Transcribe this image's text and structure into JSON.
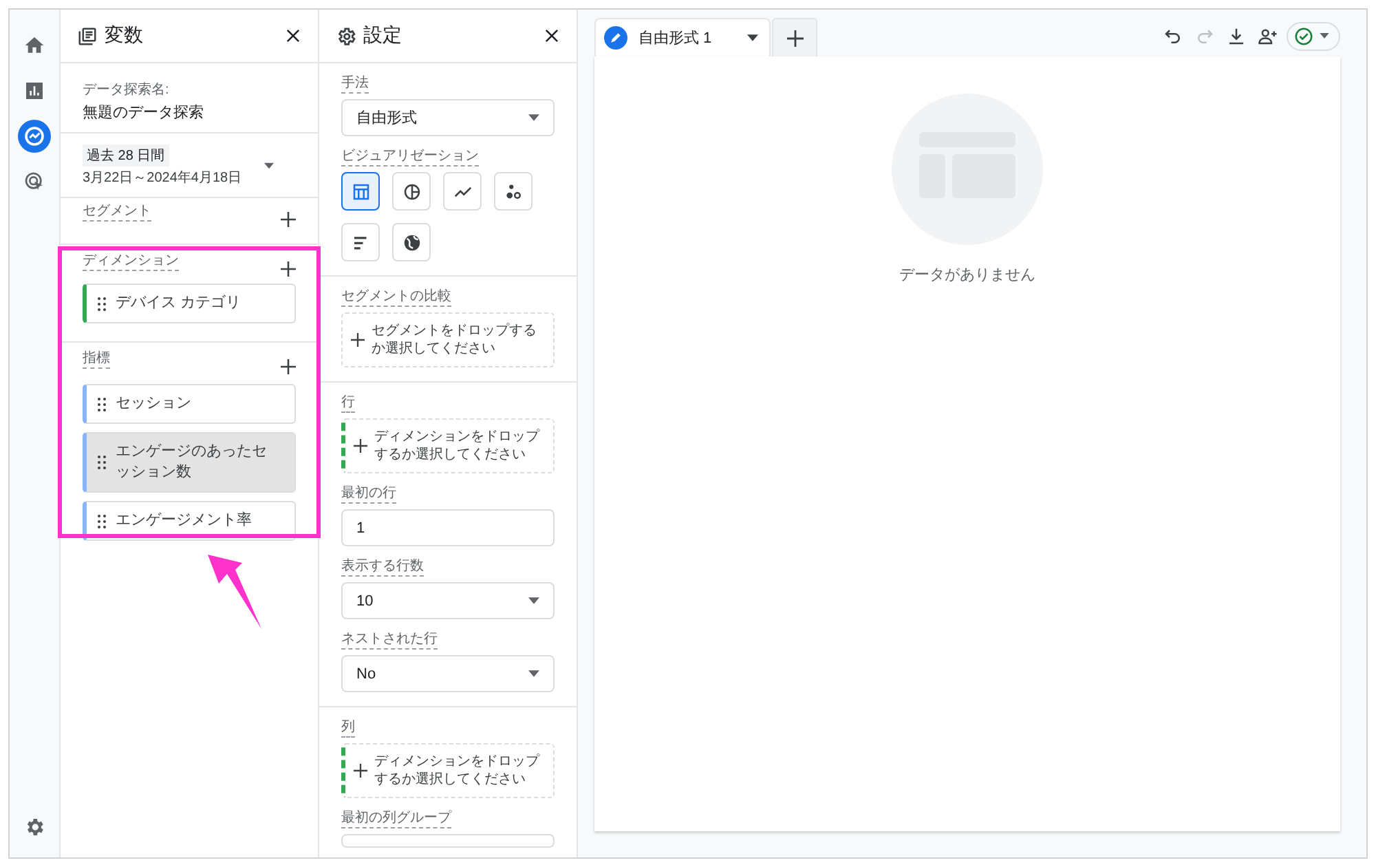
{
  "nav_rail": {
    "items": [
      {
        "selected": false
      },
      {
        "selected": false
      },
      {
        "selected": true
      },
      {
        "selected": false
      }
    ]
  },
  "variables_panel": {
    "title": "変数",
    "exploration_name_label": "データ探索名:",
    "exploration_name": "無題のデータ探索",
    "date_range": {
      "preset": "過去 28 日間",
      "range": "3月22日～2024年4月18日"
    },
    "segments": {
      "label": "セグメント"
    },
    "dimensions": {
      "label": "ディメンション",
      "items": [
        {
          "name": "デバイス カテゴリ",
          "selected": false
        }
      ]
    },
    "metrics": {
      "label": "指標",
      "items": [
        {
          "name": "セッション",
          "selected": false
        },
        {
          "name": "エンゲージのあったセッション数",
          "selected": true
        },
        {
          "name": "エンゲージメント率",
          "selected": false
        }
      ]
    }
  },
  "settings_panel": {
    "title": "設定",
    "technique": {
      "label": "手法",
      "value": "自由形式"
    },
    "visualization": {
      "label": "ビジュアリゼーション",
      "options": [
        {
          "selected": true
        },
        {
          "selected": false
        },
        {
          "selected": false
        },
        {
          "selected": false
        },
        {
          "selected": false
        },
        {
          "selected": false
        }
      ]
    },
    "segment_comparison": {
      "label": "セグメントの比較",
      "placeholder": "セグメントをドロップするか選択してください"
    },
    "rows": {
      "label": "行",
      "placeholder": "ディメンションをドロップするか選択してください"
    },
    "first_row": {
      "label": "最初の行",
      "value": "1"
    },
    "rows_shown": {
      "label": "表示する行数",
      "value": "10"
    },
    "nested_rows": {
      "label": "ネストされた行",
      "value": "No"
    },
    "columns": {
      "label": "列",
      "placeholder": "ディメンションをドロップするか選択してください"
    },
    "first_column_group": {
      "label": "最初の列グループ"
    }
  },
  "canvas": {
    "tabs": [
      {
        "label": "自由形式 1",
        "selected": true
      }
    ],
    "toolbar": [
      {
        "disabled": false
      },
      {
        "disabled": true
      },
      {
        "disabled": false
      },
      {
        "disabled": false
      }
    ],
    "empty_message": "データがありません"
  }
}
